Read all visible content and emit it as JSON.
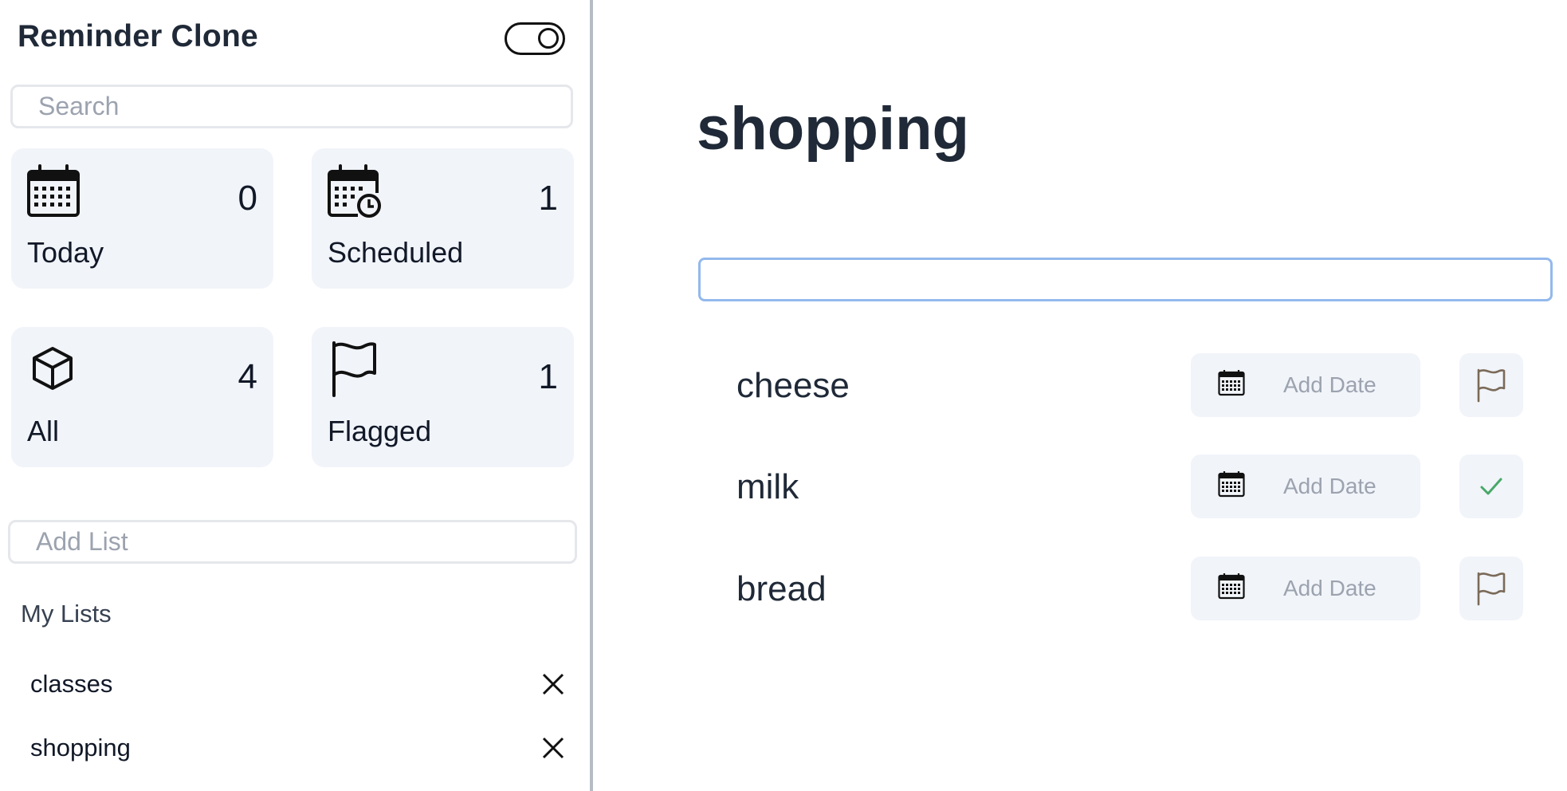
{
  "app": {
    "title": "Reminder Clone"
  },
  "search": {
    "placeholder": "Search"
  },
  "tiles": [
    {
      "label": "Today",
      "count": "0",
      "icon": "calendar-icon"
    },
    {
      "label": "Scheduled",
      "count": "1",
      "icon": "calendar-clock-icon"
    },
    {
      "label": "All",
      "count": "4",
      "icon": "cube-icon"
    },
    {
      "label": "Flagged",
      "count": "1",
      "icon": "flag-icon"
    }
  ],
  "add_list": {
    "placeholder": "Add List"
  },
  "my_lists": {
    "heading": "My Lists",
    "items": [
      {
        "name": "classes"
      },
      {
        "name": "shopping"
      }
    ]
  },
  "main": {
    "title": "shopping",
    "new_item_placeholder": "",
    "reminders": [
      {
        "text": "cheese",
        "date_label": "Add Date",
        "status_icon": "flag-icon"
      },
      {
        "text": "milk",
        "date_label": "Add Date",
        "status_icon": "checkmark-icon"
      },
      {
        "text": "bread",
        "date_label": "Add Date",
        "status_icon": "flag-icon"
      }
    ]
  },
  "colors": {
    "tile_bg": "#f1f4f9",
    "input_focus_border": "#93b9ec",
    "check_green": "#48a868",
    "flag_brown": "#7a6a58"
  }
}
